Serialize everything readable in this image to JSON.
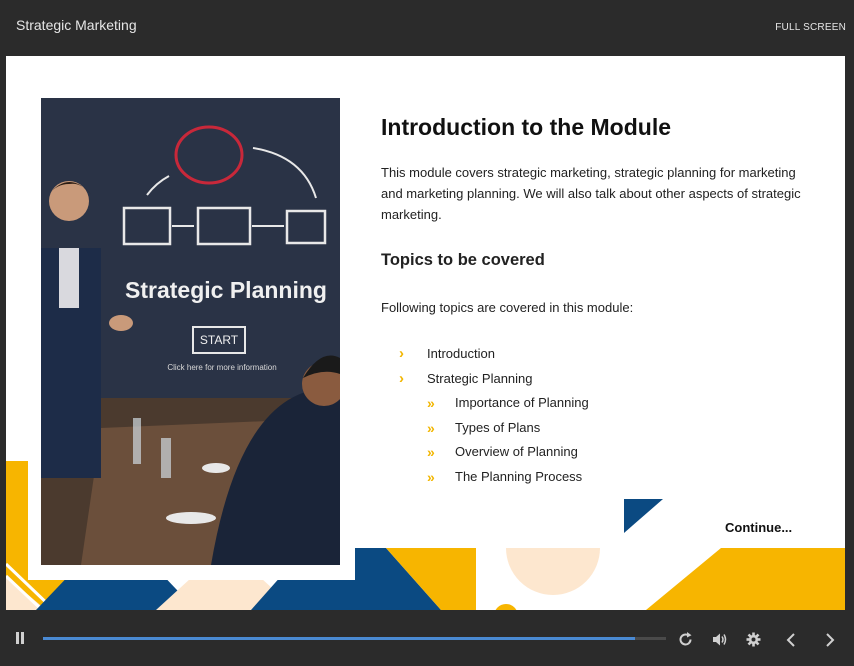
{
  "header": {
    "course_title": "Strategic Marketing",
    "fullscreen_label": "FULL SCREEN"
  },
  "slide": {
    "heading": "Introduction to the Module",
    "intro": "This module covers strategic marketing, strategic planning for marketing and marketing planning. We will also talk about other aspects of strategic marketing.",
    "subheading": "Topics to be covered",
    "lead": "Following topics are covered in this module:",
    "topics": [
      {
        "label": "Introduction",
        "level": 1
      },
      {
        "label": "Strategic Planning",
        "level": 1
      },
      {
        "label": "Importance of Planning",
        "level": 2
      },
      {
        "label": "Types of Plans",
        "level": 2
      },
      {
        "label": "Overview of Planning",
        "level": 2
      },
      {
        "label": "The Planning Process",
        "level": 2
      }
    ],
    "continue_label": "Continue...",
    "image": {
      "board_title": "Strategic Planning",
      "start_label": "START",
      "hint": "Click here for more information"
    }
  },
  "player": {
    "progress": 0.95,
    "icons": [
      "pause-icon",
      "replay-icon",
      "volume-icon",
      "gear-icon",
      "chevron-left-icon",
      "chevron-right-icon"
    ]
  },
  "colors": {
    "accent_yellow": "#f7b500",
    "accent_navy": "#0b4a82",
    "peach": "#fde7cf",
    "progress": "#4a8ad3"
  }
}
